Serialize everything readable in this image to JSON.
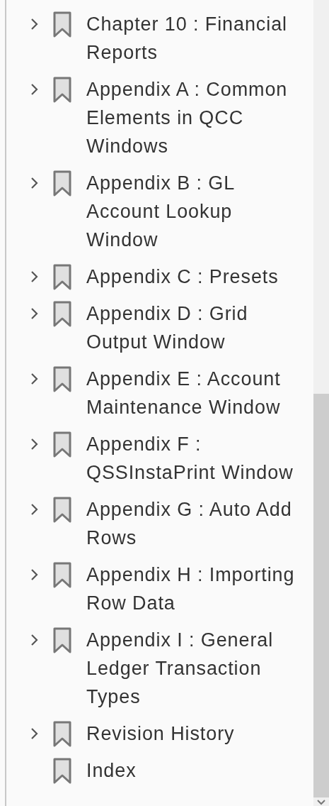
{
  "bookmarks": [
    {
      "label": "Chapter 10 : Financial Reports",
      "expandable": true
    },
    {
      "label": "Appendix A : Common Elements in QCC Windows",
      "expandable": true
    },
    {
      "label": "Appendix B : GL Account Lookup Window",
      "expandable": true
    },
    {
      "label": "Appendix C : Presets",
      "expandable": true
    },
    {
      "label": "Appendix D : Grid Output Window",
      "expandable": true
    },
    {
      "label": "Appendix E : Account Maintenance Window",
      "expandable": true
    },
    {
      "label": "Appendix F : QSSInstaPrint Window",
      "expandable": true
    },
    {
      "label": "Appendix G : Auto Add Rows",
      "expandable": true
    },
    {
      "label": "Appendix H : Importing Row Data",
      "expandable": true
    },
    {
      "label": "Appendix I : General Ledger Transaction Types",
      "expandable": true
    },
    {
      "label": "Revision History",
      "expandable": true
    },
    {
      "label": "Index",
      "expandable": false
    }
  ]
}
